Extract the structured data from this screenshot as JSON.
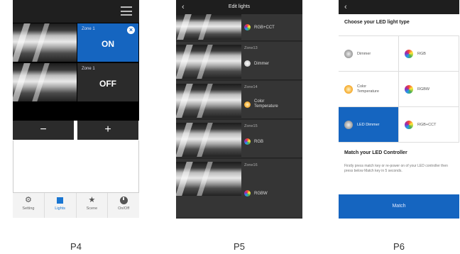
{
  "captions": {
    "p4": "P4",
    "p5": "P5",
    "p6": "P6"
  },
  "p4": {
    "zones": [
      {
        "label": "Zone 1",
        "state": "ON"
      },
      {
        "label": "Zone 1",
        "state": "OFF"
      }
    ],
    "stepper": {
      "minus": "−",
      "plus": "+"
    },
    "tabs": [
      {
        "label": "Setting",
        "icon": "gear-icon"
      },
      {
        "label": "Lights",
        "icon": "square-icon"
      },
      {
        "label": "Scene",
        "icon": "star-icon"
      },
      {
        "label": "On/Off",
        "icon": "power-icon"
      }
    ],
    "accent": "#1565c0"
  },
  "p5": {
    "title": "Edit lights",
    "rows": [
      {
        "zone": "",
        "type": "RGB+CCT",
        "icon": "rgb-dot"
      },
      {
        "zone": "Zone13",
        "type": "Dimmer",
        "icon": "dimmer-dot"
      },
      {
        "zone": "Zone14",
        "type": "Color Temperature",
        "icon": "cct-dot"
      },
      {
        "zone": "Zone15",
        "type": "RGB",
        "icon": "rgb-dot"
      },
      {
        "zone": "Zone16",
        "type": "RGBW",
        "icon": "rgb-dot"
      }
    ]
  },
  "p6": {
    "title": "Choose your LED light type",
    "types": [
      {
        "label": "Dimmer",
        "icon": "dimmer-dot"
      },
      {
        "label": "RGB",
        "icon": "rgb-dot"
      },
      {
        "label": "Color Temperature",
        "icon": "cct-dot"
      },
      {
        "label": "RGBW",
        "icon": "rgb-dot"
      },
      {
        "label": "LED Dimmer",
        "icon": "dimmer-dot",
        "selected": true
      },
      {
        "label": "RGB+CCT",
        "icon": "rgb-dot"
      }
    ],
    "match_title": "Match your LED Controller",
    "match_desc": "Firstly press match key or re-power on of your LED controller then press below Match key in 5 seconds.",
    "match_button": "Match"
  }
}
